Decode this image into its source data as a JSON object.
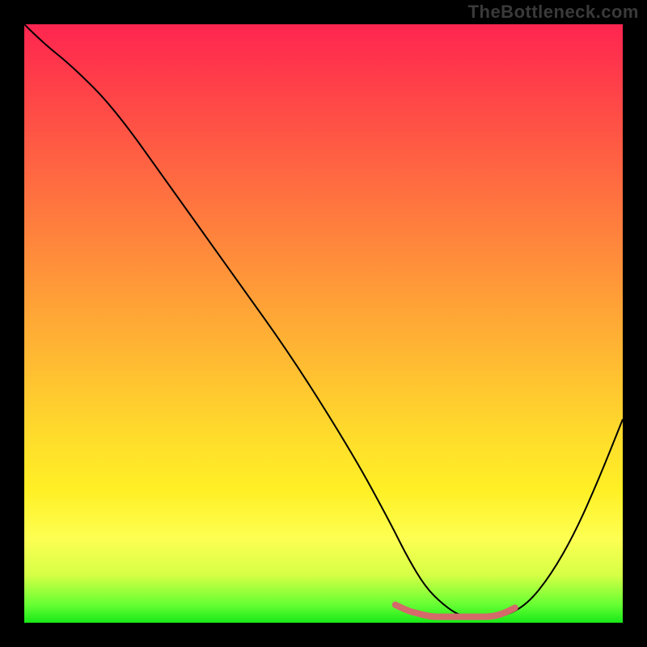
{
  "watermark": "TheBottleneck.com",
  "colors": {
    "page_bg": "#000000",
    "curve_stroke": "#000000",
    "segment_stroke": "#d46a6a",
    "gradient_stops": [
      "#ff2550",
      "#ff3a4a",
      "#ff5a44",
      "#ff7a3e",
      "#ff9a38",
      "#ffba32",
      "#ffda2c",
      "#fff026",
      "#fdff52",
      "#d6ff45",
      "#66ff33",
      "#18e818"
    ]
  },
  "chart_data": {
    "type": "line",
    "title": "",
    "xlabel": "",
    "ylabel": "",
    "xlim": [
      0,
      100
    ],
    "ylim": [
      0,
      100
    ],
    "note": "Axes are unlabeled; x/y are 0–100 proportional to the plot area. main_curve is the black V-shape; red_segment is the pink near-bottom segment.",
    "series": [
      {
        "name": "main_curve",
        "x": [
          0,
          3,
          8,
          15,
          25,
          35,
          45,
          55,
          61,
          64,
          67,
          70,
          73,
          77,
          80,
          84,
          88,
          92,
          96,
          100
        ],
        "y": [
          100,
          97,
          93,
          86,
          72,
          58,
          44,
          28,
          17,
          11,
          6,
          3,
          1,
          1,
          1,
          3,
          8,
          15,
          24,
          34
        ]
      },
      {
        "name": "red_segment",
        "x": [
          62,
          64,
          66,
          68,
          70,
          72,
          74,
          76,
          78,
          80,
          82
        ],
        "y": [
          3,
          2,
          1.5,
          1,
          1,
          1,
          1,
          1,
          1,
          1.5,
          2.5
        ]
      }
    ]
  }
}
